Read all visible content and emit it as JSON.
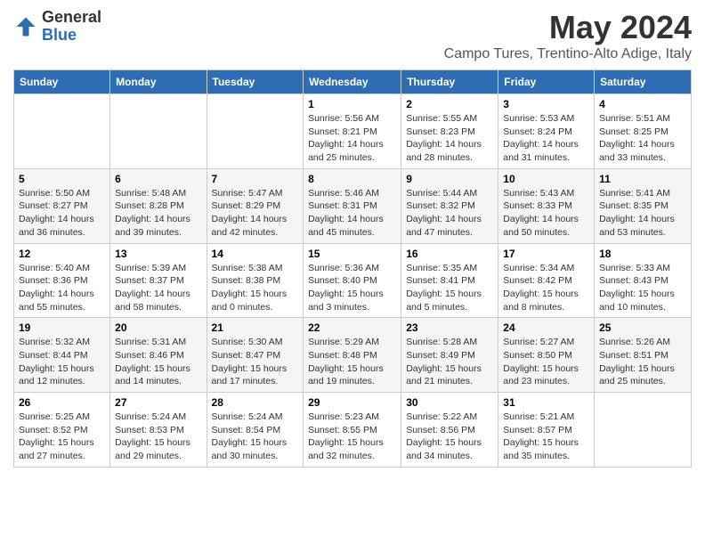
{
  "header": {
    "logo_general": "General",
    "logo_blue": "Blue",
    "month_title": "May 2024",
    "subtitle": "Campo Tures, Trentino-Alto Adige, Italy"
  },
  "days_of_week": [
    "Sunday",
    "Monday",
    "Tuesday",
    "Wednesday",
    "Thursday",
    "Friday",
    "Saturday"
  ],
  "weeks": [
    [
      {
        "day": "",
        "info": ""
      },
      {
        "day": "",
        "info": ""
      },
      {
        "day": "",
        "info": ""
      },
      {
        "day": "1",
        "info": "Sunrise: 5:56 AM\nSunset: 8:21 PM\nDaylight: 14 hours and 25 minutes."
      },
      {
        "day": "2",
        "info": "Sunrise: 5:55 AM\nSunset: 8:23 PM\nDaylight: 14 hours and 28 minutes."
      },
      {
        "day": "3",
        "info": "Sunrise: 5:53 AM\nSunset: 8:24 PM\nDaylight: 14 hours and 31 minutes."
      },
      {
        "day": "4",
        "info": "Sunrise: 5:51 AM\nSunset: 8:25 PM\nDaylight: 14 hours and 33 minutes."
      }
    ],
    [
      {
        "day": "5",
        "info": "Sunrise: 5:50 AM\nSunset: 8:27 PM\nDaylight: 14 hours and 36 minutes."
      },
      {
        "day": "6",
        "info": "Sunrise: 5:48 AM\nSunset: 8:28 PM\nDaylight: 14 hours and 39 minutes."
      },
      {
        "day": "7",
        "info": "Sunrise: 5:47 AM\nSunset: 8:29 PM\nDaylight: 14 hours and 42 minutes."
      },
      {
        "day": "8",
        "info": "Sunrise: 5:46 AM\nSunset: 8:31 PM\nDaylight: 14 hours and 45 minutes."
      },
      {
        "day": "9",
        "info": "Sunrise: 5:44 AM\nSunset: 8:32 PM\nDaylight: 14 hours and 47 minutes."
      },
      {
        "day": "10",
        "info": "Sunrise: 5:43 AM\nSunset: 8:33 PM\nDaylight: 14 hours and 50 minutes."
      },
      {
        "day": "11",
        "info": "Sunrise: 5:41 AM\nSunset: 8:35 PM\nDaylight: 14 hours and 53 minutes."
      }
    ],
    [
      {
        "day": "12",
        "info": "Sunrise: 5:40 AM\nSunset: 8:36 PM\nDaylight: 14 hours and 55 minutes."
      },
      {
        "day": "13",
        "info": "Sunrise: 5:39 AM\nSunset: 8:37 PM\nDaylight: 14 hours and 58 minutes."
      },
      {
        "day": "14",
        "info": "Sunrise: 5:38 AM\nSunset: 8:38 PM\nDaylight: 15 hours and 0 minutes."
      },
      {
        "day": "15",
        "info": "Sunrise: 5:36 AM\nSunset: 8:40 PM\nDaylight: 15 hours and 3 minutes."
      },
      {
        "day": "16",
        "info": "Sunrise: 5:35 AM\nSunset: 8:41 PM\nDaylight: 15 hours and 5 minutes."
      },
      {
        "day": "17",
        "info": "Sunrise: 5:34 AM\nSunset: 8:42 PM\nDaylight: 15 hours and 8 minutes."
      },
      {
        "day": "18",
        "info": "Sunrise: 5:33 AM\nSunset: 8:43 PM\nDaylight: 15 hours and 10 minutes."
      }
    ],
    [
      {
        "day": "19",
        "info": "Sunrise: 5:32 AM\nSunset: 8:44 PM\nDaylight: 15 hours and 12 minutes."
      },
      {
        "day": "20",
        "info": "Sunrise: 5:31 AM\nSunset: 8:46 PM\nDaylight: 15 hours and 14 minutes."
      },
      {
        "day": "21",
        "info": "Sunrise: 5:30 AM\nSunset: 8:47 PM\nDaylight: 15 hours and 17 minutes."
      },
      {
        "day": "22",
        "info": "Sunrise: 5:29 AM\nSunset: 8:48 PM\nDaylight: 15 hours and 19 minutes."
      },
      {
        "day": "23",
        "info": "Sunrise: 5:28 AM\nSunset: 8:49 PM\nDaylight: 15 hours and 21 minutes."
      },
      {
        "day": "24",
        "info": "Sunrise: 5:27 AM\nSunset: 8:50 PM\nDaylight: 15 hours and 23 minutes."
      },
      {
        "day": "25",
        "info": "Sunrise: 5:26 AM\nSunset: 8:51 PM\nDaylight: 15 hours and 25 minutes."
      }
    ],
    [
      {
        "day": "26",
        "info": "Sunrise: 5:25 AM\nSunset: 8:52 PM\nDaylight: 15 hours and 27 minutes."
      },
      {
        "day": "27",
        "info": "Sunrise: 5:24 AM\nSunset: 8:53 PM\nDaylight: 15 hours and 29 minutes."
      },
      {
        "day": "28",
        "info": "Sunrise: 5:24 AM\nSunset: 8:54 PM\nDaylight: 15 hours and 30 minutes."
      },
      {
        "day": "29",
        "info": "Sunrise: 5:23 AM\nSunset: 8:55 PM\nDaylight: 15 hours and 32 minutes."
      },
      {
        "day": "30",
        "info": "Sunrise: 5:22 AM\nSunset: 8:56 PM\nDaylight: 15 hours and 34 minutes."
      },
      {
        "day": "31",
        "info": "Sunrise: 5:21 AM\nSunset: 8:57 PM\nDaylight: 15 hours and 35 minutes."
      },
      {
        "day": "",
        "info": ""
      }
    ]
  ]
}
